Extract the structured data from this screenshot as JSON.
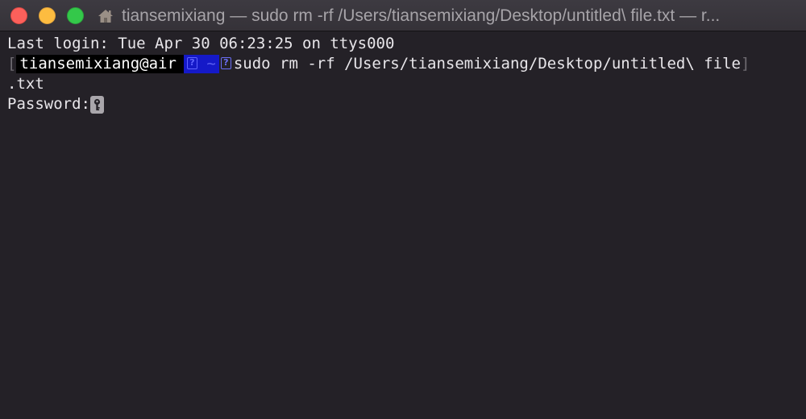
{
  "window": {
    "title": "tiansemixiang — sudo rm -rf /Users/tiansemixiang/Desktop/untitled\\ file.txt — r...",
    "controls": {
      "close": "close-button",
      "minimize": "minimize-button",
      "zoom": "zoom-button"
    },
    "title_icon": "home-folder-icon"
  },
  "terminal": {
    "last_login": "Last login: Tue Apr 30 06:23:25 on ttys000",
    "prompt": {
      "open_bracket": "[",
      "user_host": "tiansemixiang@air",
      "dir_glyph": "?",
      "dir": "~",
      "status_glyph": "?",
      "close_bracket": "]"
    },
    "command_line_1": "sudo rm -rf /Users/tiansemixiang/Desktop/untitled\\ file",
    "command_line_2": ".txt",
    "password_prompt": "Password:",
    "cursor_icon": "key-icon"
  },
  "colors": {
    "background": "#242127",
    "text": "#e8e6ea",
    "user_segment_bg": "#000000",
    "dir_segment_bg": "#1519c8",
    "glyph_accent": "#5f64ff",
    "close": "#fc605b",
    "minimize": "#fdbc40",
    "zoom": "#34c84a"
  }
}
